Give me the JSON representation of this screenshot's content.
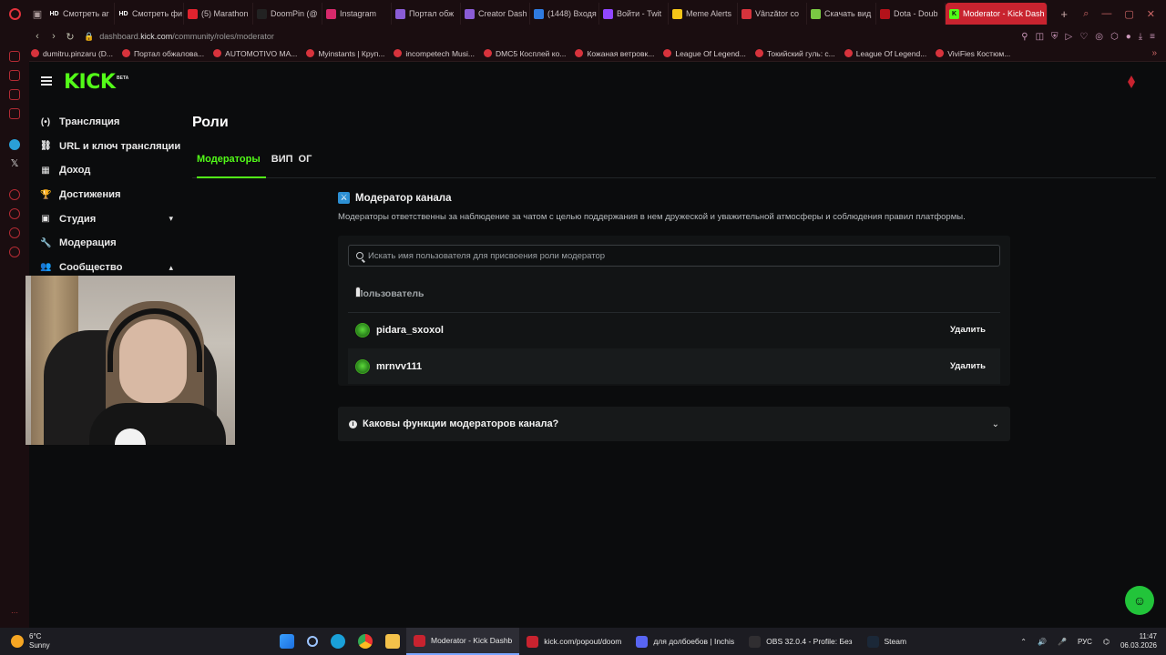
{
  "browser": {
    "tabs": [
      {
        "label": "Смотреть ar",
        "fav_text": "HD",
        "fav_color": "#1a0d10"
      },
      {
        "label": "Смотреть фи",
        "fav_text": "HD",
        "fav_color": "#1a0d10"
      },
      {
        "label": "(5) Marathon",
        "fav_text": "",
        "fav_color": "#e0232e"
      },
      {
        "label": "DoomPin (@",
        "fav_text": "",
        "fav_color": "#222222"
      },
      {
        "label": "Instagram",
        "fav_text": "",
        "fav_color": "#d6296b"
      },
      {
        "label": "Портал обж",
        "fav_text": "",
        "fav_color": "#8a5cd6"
      },
      {
        "label": "Creator Dash",
        "fav_text": "",
        "fav_color": "#8a5cd6"
      },
      {
        "label": "(1448) Входя",
        "fav_text": "",
        "fav_color": "#2f7be0"
      },
      {
        "label": "Войти - Twit",
        "fav_text": "",
        "fav_color": "#9147ff"
      },
      {
        "label": "Meme Alerts",
        "fav_text": "",
        "fav_color": "#f5c518"
      },
      {
        "label": "Vânzător co",
        "fav_text": "",
        "fav_color": "#d6333c"
      },
      {
        "label": "Скачать вид",
        "fav_text": "",
        "fav_color": "#7ac943"
      },
      {
        "label": "Dota - Doub",
        "fav_text": "",
        "fav_color": "#b3121a"
      }
    ],
    "active_tab": {
      "label": "Moderator - Kick Dash",
      "fav_text": "K",
      "fav_color": "#53fc18"
    },
    "url_prefix": "dashboard.",
    "url_domain": "kick.com",
    "url_path": "/community/roles/moderator",
    "bookmarks": [
      "dumitru.pinzaru (D...",
      "Портал обжалова...",
      "AUTOMOTIVO MA...",
      "Myinstants | Круп...",
      "incompetech Musi...",
      "DMC5 Косплей ко...",
      "Кожаная ветровк...",
      "League Of Legend...",
      "Токийский гуль: с...",
      "League Of Legend...",
      "ViviFies Костюм..."
    ]
  },
  "kick": {
    "logo": "KICK",
    "beta": "BETA",
    "nav": [
      {
        "label": "Трансляция",
        "icon": "(•)"
      },
      {
        "label": "URL и ключ трансляции",
        "icon": "⛓"
      },
      {
        "label": "Доход",
        "icon": "▦"
      },
      {
        "label": "Достижения",
        "icon": "🏆"
      },
      {
        "label": "Студия",
        "icon": "▣",
        "chevron": "▾"
      },
      {
        "label": "Модерация",
        "icon": "🔧"
      },
      {
        "label": "Сообщество",
        "icon": "👥",
        "chevron": "▴"
      }
    ],
    "page_title": "Роли",
    "role_tabs": [
      "Модераторы",
      "ВИП",
      "ОГ"
    ],
    "panel_title": "Модератор канала",
    "panel_desc": "Модераторы ответственны за наблюдение за чатом с целью поддержания в нем дружеской и уважительной атмосферы и соблюдения правил платформы.",
    "search_placeholder": "Искать имя пользователя для присвоения роли модератор",
    "col_user": "Пользователь",
    "moderators": [
      {
        "name": "pidara_sxoxol",
        "action": "Удалить"
      },
      {
        "name": "mrnvv111",
        "action": "Удалить"
      }
    ],
    "faq_question": "Каковы функции модераторов канала?"
  },
  "taskbar": {
    "weather_temp": "6°C",
    "weather_desc": "Sunny",
    "apps": [
      {
        "label": "Moderator - Kick Dashb",
        "color": "#c8232f",
        "active": true
      },
      {
        "label": "kick.com/popout/doom",
        "color": "#c8232f",
        "active": false
      },
      {
        "label": "для долбоебов | Inchis",
        "color": "#5865f2",
        "active": false
      },
      {
        "label": "OBS 32.0.4 - Profile: Без",
        "color": "#302e31",
        "active": false
      },
      {
        "label": "Steam",
        "color": "#1b2838",
        "active": false
      }
    ],
    "lang": "РУС",
    "time": "11:47",
    "date": "06.03.2026"
  }
}
